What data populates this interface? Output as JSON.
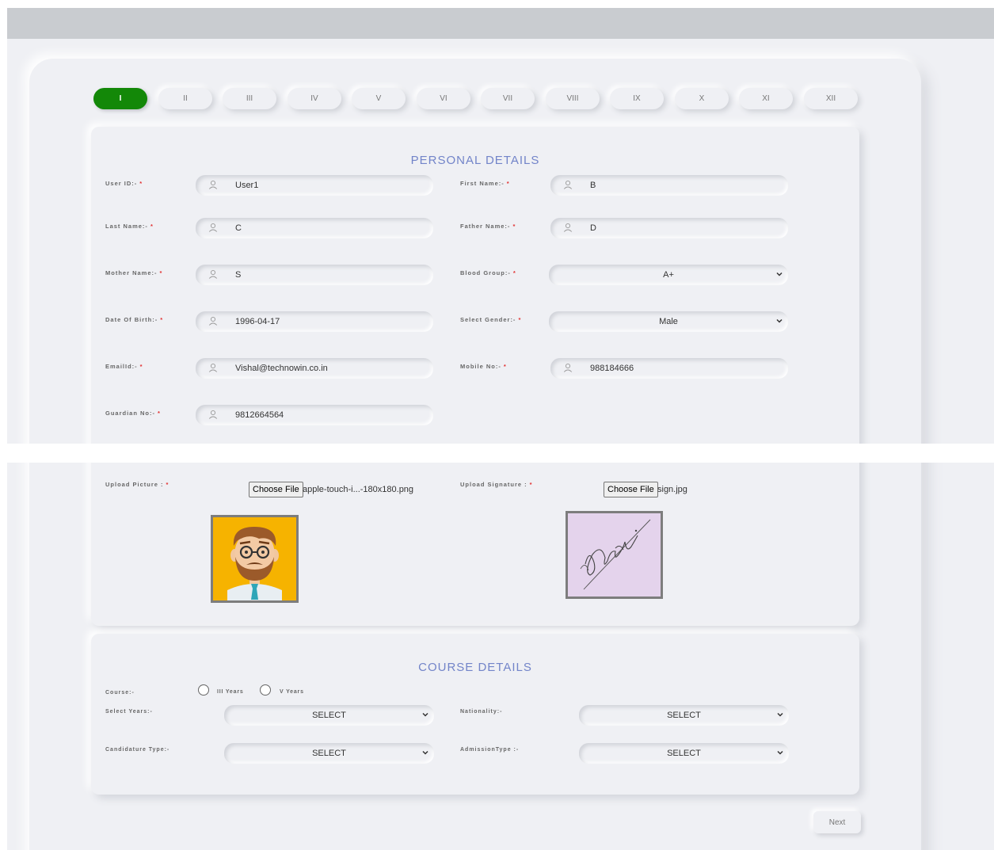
{
  "steps": [
    "I",
    "II",
    "III",
    "IV",
    "V",
    "VI",
    "VII",
    "VIII",
    "IX",
    "X",
    "XI",
    "XII"
  ],
  "personal": {
    "title": "PERSONAL DETAILS",
    "required_mark": "*",
    "user_id": {
      "label": "User ID:-",
      "value": "User1"
    },
    "first_name": {
      "label": "First Name:-",
      "value": "B"
    },
    "last_name": {
      "label": "Last Name:-",
      "value": "C"
    },
    "father_name": {
      "label": "Father Name:-",
      "value": "D"
    },
    "mother_name": {
      "label": "Mother Name:-",
      "value": "S"
    },
    "blood_group": {
      "label": "Blood Group:-",
      "value": "A+"
    },
    "dob": {
      "label": "Date Of Birth:-",
      "value": "1996-04-17"
    },
    "gender": {
      "label": "Select Gender:-",
      "value": "Male"
    },
    "email": {
      "label": "EmailId:-",
      "value": "Vishal@technowin.co.in"
    },
    "mobile": {
      "label": "Mobile No:-",
      "value": "988184666"
    },
    "guardian": {
      "label": "Guardian No:-",
      "value": "9812664564"
    },
    "upload_picture": {
      "label": "Upload Picture :",
      "button": "Choose File",
      "file": "apple-touch-i...-180x180.png"
    },
    "upload_signature": {
      "label": "Upload Signature :",
      "button": "Choose File",
      "file": "sign.jpg"
    }
  },
  "course": {
    "title": "COURSE DETAILS",
    "course_label": "Course:-",
    "options": [
      "III Years",
      "V Years"
    ],
    "select_years": {
      "label": "Select Years:-",
      "value": "SELECT"
    },
    "nationality": {
      "label": "Nationality:-",
      "value": "SELECT"
    },
    "candidature": {
      "label": "Candidature Type:-",
      "value": "SELECT"
    },
    "admission": {
      "label": "AdmissionType :-",
      "value": "SELECT"
    }
  },
  "next_label": "Next",
  "colors": {
    "accent": "#138808",
    "title": "#7284c9",
    "required": "#e23030",
    "background": "#eff0f4"
  },
  "icons": [
    "user-icon",
    "chevron-down-icon",
    "avatar-image",
    "signature-image"
  ]
}
